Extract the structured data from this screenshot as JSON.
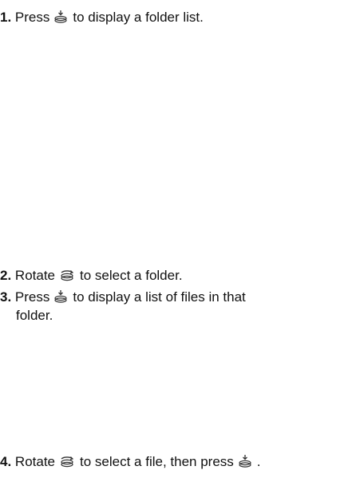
{
  "steps": [
    {
      "number": "1.",
      "before": "Press",
      "icon": "press-dial-icon",
      "after": "to display a folder list."
    },
    {
      "number": "2.",
      "before": "Rotate",
      "icon": "rotate-dial-icon",
      "after": "to select a folder."
    },
    {
      "number": "3.",
      "before": "Press",
      "icon": "press-dial-icon",
      "after": "to display a list of files in that",
      "continuation": "folder."
    },
    {
      "number": "4.",
      "before": "Rotate",
      "icon": "rotate-dial-icon",
      "middle": "to select a file, then press",
      "icon2": "press-dial-icon",
      "after": "."
    }
  ]
}
